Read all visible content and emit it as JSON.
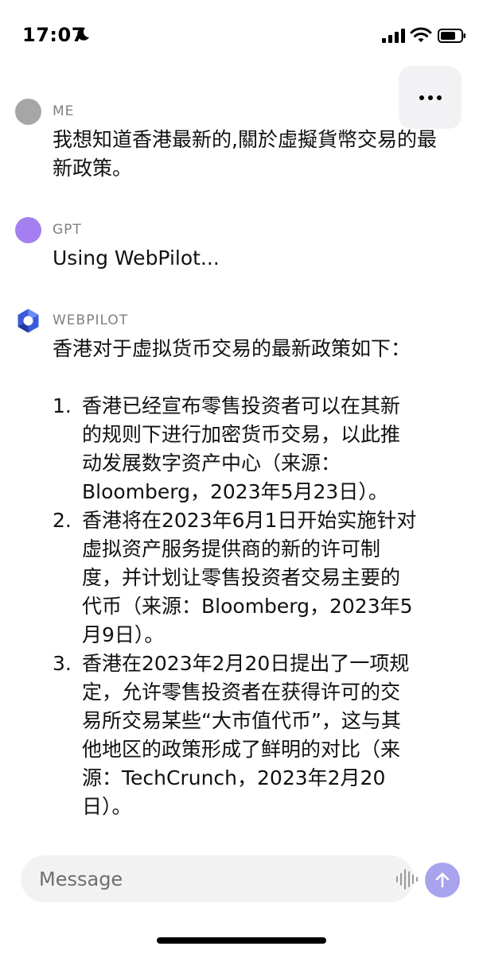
{
  "status_bar": {
    "time": "17:07"
  },
  "conversation": {
    "messages": [
      {
        "sender": "ME",
        "text": "我想知道香港最新的,關於虛擬貨幣交易的最新政策。"
      },
      {
        "sender": "GPT",
        "text": "Using WebPilot..."
      },
      {
        "sender": "WEBPILOT",
        "intro": "香港对于虚拟货币交易的最新政策如下：",
        "items": [
          {
            "number": "1.",
            "text": "香港已经宣布零售投资者可以在其新的规则下进行加密货币交易，以此推动发展数字资产中心（来源：Bloomberg，2023年5月23日）。"
          },
          {
            "number": "2.",
            "text": "香港将在2023年6月1日开始实施针对虚拟资产服务提供商的新的许可制度，并计划让零售投资者交易主要的代币（来源：Bloomberg，2023年5月9日）。"
          },
          {
            "number": "3.",
            "text": "香港在2023年2月20日提出了一项规定，允许零售投资者在获得许可的交易所交易某些“大市值代币”，这与其他地区的政策形成了鲜明的对比（来源：TechCrunch，2023年2月20日）。"
          }
        ]
      }
    ]
  },
  "composer": {
    "placeholder": "Message"
  },
  "icons": {
    "status": [
      "moon-icon",
      "signal-icon",
      "wifi-icon",
      "battery-icon"
    ],
    "more": "more-dots-icon",
    "webpilot_avatar": "webpilot-logo-icon",
    "voice": "waveform-icon",
    "send": "arrow-up-icon"
  },
  "colors": {
    "me_avatar": "#a6a6a6",
    "gpt_avatar": "#a57ff0",
    "webpilot_logo": "#3b5bdb",
    "send_button": "#a9a3ee",
    "composer_bg": "#f2f2f2"
  }
}
